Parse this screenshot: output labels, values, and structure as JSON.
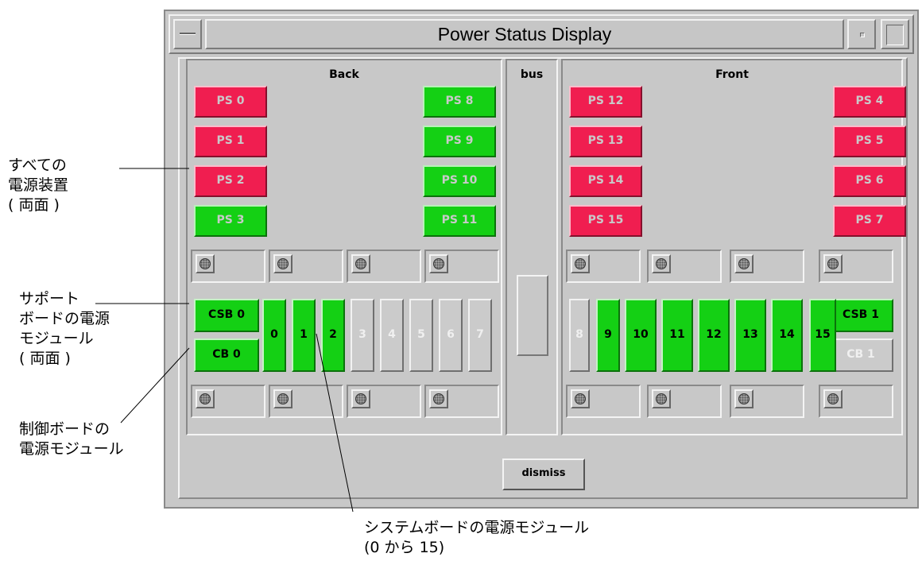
{
  "window": {
    "title": "Power Status Display"
  },
  "panels": {
    "back": "Back",
    "bus": "bus",
    "front": "Front"
  },
  "colors": {
    "fault": "#f01e50",
    "ok": "#14d014",
    "absent": "#cbcbcb"
  },
  "back_ps": [
    {
      "label": "PS 0",
      "status": "fault"
    },
    {
      "label": "PS 1",
      "status": "fault"
    },
    {
      "label": "PS 2",
      "status": "fault"
    },
    {
      "label": "PS 3",
      "status": "ok"
    },
    {
      "label": "PS 8",
      "status": "ok"
    },
    {
      "label": "PS 9",
      "status": "ok"
    },
    {
      "label": "PS 10",
      "status": "ok"
    },
    {
      "label": "PS 11",
      "status": "ok"
    }
  ],
  "front_ps": [
    {
      "label": "PS 12",
      "status": "fault"
    },
    {
      "label": "PS 13",
      "status": "fault"
    },
    {
      "label": "PS 14",
      "status": "fault"
    },
    {
      "label": "PS 15",
      "status": "fault"
    },
    {
      "label": "PS 4",
      "status": "fault"
    },
    {
      "label": "PS 5",
      "status": "fault"
    },
    {
      "label": "PS 6",
      "status": "fault"
    },
    {
      "label": "PS 7",
      "status": "fault"
    }
  ],
  "support_boards": [
    {
      "label": "CSB 0",
      "status": "ok"
    },
    {
      "label": "CB 0",
      "status": "ok"
    },
    {
      "label": "CSB 1",
      "status": "ok"
    },
    {
      "label": "CB 1",
      "status": "absent"
    }
  ],
  "system_boards": [
    {
      "label": "0",
      "status": "ok"
    },
    {
      "label": "1",
      "status": "ok"
    },
    {
      "label": "2",
      "status": "ok"
    },
    {
      "label": "3",
      "status": "absent"
    },
    {
      "label": "4",
      "status": "absent"
    },
    {
      "label": "5",
      "status": "absent"
    },
    {
      "label": "6",
      "status": "absent"
    },
    {
      "label": "7",
      "status": "absent"
    },
    {
      "label": "8",
      "status": "absent"
    },
    {
      "label": "9",
      "status": "ok"
    },
    {
      "label": "10",
      "status": "ok"
    },
    {
      "label": "11",
      "status": "ok"
    },
    {
      "label": "12",
      "status": "ok"
    },
    {
      "label": "13",
      "status": "ok"
    },
    {
      "label": "14",
      "status": "ok"
    },
    {
      "label": "15",
      "status": "ok"
    }
  ],
  "buttons": {
    "dismiss": "dismiss"
  },
  "annotations": {
    "all_power_supplies": "すべての\n電源装置\n( 両面 )",
    "support_board_modules": "サポート\nボードの電源\nモジュール\n( 両面 )",
    "control_board_modules": "制御ボードの\n電源モジュール",
    "system_board_modules": "システムボードの電源モジュール\n(0 から 15)"
  }
}
